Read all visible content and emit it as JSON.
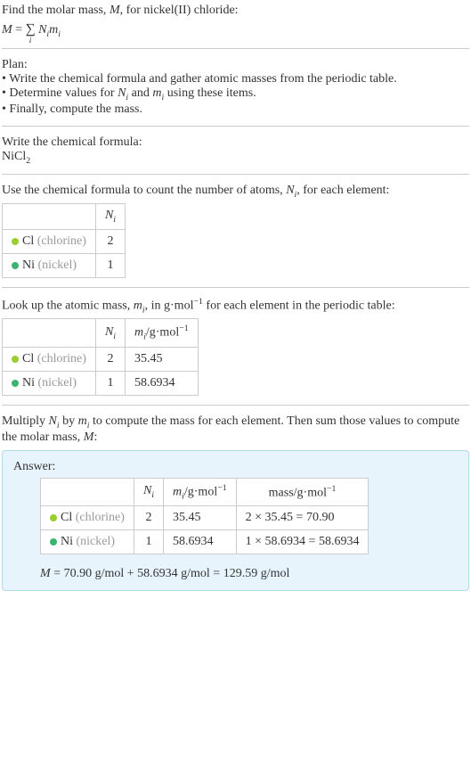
{
  "intro": {
    "line1_prefix": "Find the molar mass, ",
    "line1_var": "M",
    "line1_suffix": ", for nickel(II) chloride:",
    "formula_lhs": "M",
    "formula_eq": " = ",
    "formula_sum_idx": "i",
    "formula_rhs_N": "N",
    "formula_rhs_Ni_sub": "i",
    "formula_rhs_m": "m",
    "formula_rhs_mi_sub": "i"
  },
  "plan": {
    "title": "Plan:",
    "item1": "• Write the chemical formula and gather atomic masses from the periodic table.",
    "item2_prefix": "• Determine values for ",
    "item2_N": "N",
    "item2_i1": "i",
    "item2_mid": " and ",
    "item2_m": "m",
    "item2_i2": "i",
    "item2_suffix": " using these items.",
    "item3": "• Finally, compute the mass."
  },
  "chemformula": {
    "title": "Write the chemical formula:",
    "formula_base": "NiCl",
    "formula_sub": "2"
  },
  "count": {
    "title_prefix": "Use the chemical formula to count the number of atoms, ",
    "title_N": "N",
    "title_i": "i",
    "title_suffix": ", for each element:",
    "header_N": "N",
    "header_i": "i",
    "cl_sym": "Cl",
    "cl_name": " (chlorine)",
    "cl_count": "2",
    "ni_sym": "Ni",
    "ni_name": " (nickel)",
    "ni_count": "1"
  },
  "lookup": {
    "title_prefix": "Look up the atomic mass, ",
    "title_m": "m",
    "title_i": "i",
    "title_mid": ", in g·mol",
    "title_exp": "−1",
    "title_suffix": " for each element in the periodic table:",
    "header_N": "N",
    "header_Ni": "i",
    "header_m": "m",
    "header_mi": "i",
    "header_unit": "/g·mol",
    "header_exp": "−1",
    "cl_sym": "Cl",
    "cl_name": " (chlorine)",
    "cl_N": "2",
    "cl_m": "35.45",
    "ni_sym": "Ni",
    "ni_name": " (nickel)",
    "ni_N": "1",
    "ni_m": "58.6934"
  },
  "multiply": {
    "prefix": "Multiply ",
    "N": "N",
    "Ni": "i",
    "mid1": " by ",
    "m": "m",
    "mi": "i",
    "mid2": " to compute the mass for each element. Then sum those values to compute the molar mass, ",
    "M": "M",
    "suffix": ":"
  },
  "answer": {
    "label": "Answer:",
    "header_N": "N",
    "header_Ni": "i",
    "header_m": "m",
    "header_mi": "i",
    "header_munit": "/g·mol",
    "header_mexp": "−1",
    "header_mass": "mass/g·mol",
    "header_massexp": "−1",
    "cl_sym": "Cl",
    "cl_name": " (chlorine)",
    "cl_N": "2",
    "cl_m": "35.45",
    "cl_mass": "2 × 35.45 = 70.90",
    "ni_sym": "Ni",
    "ni_name": " (nickel)",
    "ni_N": "1",
    "ni_m": "58.6934",
    "ni_mass": "1 × 58.6934 = 58.6934",
    "final_M": "M",
    "final_eq": " = 70.90 g/mol + 58.6934 g/mol = 129.59 g/mol"
  }
}
